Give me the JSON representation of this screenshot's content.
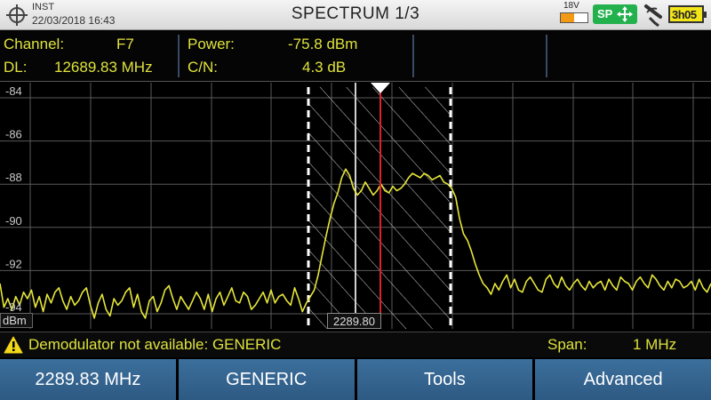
{
  "status_bar": {
    "mode": "INST",
    "datetime": "22/03/2018 16:43",
    "title": "SPECTRUM 1/3",
    "lnb_voltage": "18V",
    "lnb_level": 0.5,
    "sp_badge": "SP",
    "battery": "3h05",
    "icons": [
      "crosshair-icon",
      "move-arrows-icon",
      "antenna-icon",
      "battery-icon"
    ]
  },
  "info": {
    "channel_label": "Channel:",
    "channel_value": "F7",
    "dl_label": "DL:",
    "dl_value": "12689.83 MHz",
    "power_label": "Power:",
    "power_value": "-75.8 dBm",
    "cn_label": "C/N:",
    "cn_value": "4.3 dB"
  },
  "colors": {
    "trace": "#e6e63a",
    "marker": "#e0202a",
    "text": "#dfe33c",
    "softkey": "#33628e"
  },
  "chart_data": {
    "type": "line",
    "ylabel": "dBm",
    "y_ticks": [
      "-84",
      "-86",
      "-88",
      "-90",
      "-92",
      "-94"
    ],
    "ylim": [
      -94.7,
      -83.3
    ],
    "marker_label": "2289.80",
    "grid": true,
    "series": [
      {
        "values": [
          -92.6,
          -93.7,
          -93.3,
          -93.8,
          -93.2,
          -93.6,
          -93.0,
          -93.3,
          -92.9,
          -93.7,
          -93.2,
          -93.9,
          -93.1,
          -93.5,
          -93.0,
          -92.8,
          -93.4,
          -93.8,
          -93.2,
          -93.6,
          -93.4,
          -93.0,
          -92.8,
          -93.6,
          -94.2,
          -93.5,
          -93.1,
          -93.8,
          -94.1,
          -93.3,
          -93.6,
          -93.4,
          -93.0,
          -92.8,
          -93.7,
          -93.1,
          -93.9,
          -94.2,
          -93.4,
          -93.2,
          -93.9,
          -93.5,
          -92.9,
          -92.7,
          -93.3,
          -93.8,
          -93.2,
          -93.5,
          -93.8,
          -93.4,
          -93.0,
          -93.3,
          -93.8,
          -93.1,
          -93.9,
          -93.3,
          -93.0,
          -93.6,
          -93.2,
          -92.8,
          -93.4,
          -93.5,
          -93.0,
          -93.2,
          -93.8,
          -93.6,
          -93.3,
          -93.0,
          -93.5,
          -92.9,
          -93.5,
          -93.2,
          -93.1,
          -93.4,
          -93.6,
          -92.8,
          -93.3,
          -93.9,
          -93.5,
          -93.2,
          -92.9,
          -92.2,
          -91.3,
          -90.4,
          -89.6,
          -88.9,
          -88.4,
          -87.7,
          -87.3,
          -87.6,
          -88.2,
          -88.5,
          -88.3,
          -87.9,
          -88.2,
          -88.5,
          -88.3,
          -88.0,
          -88.3,
          -88.4,
          -88.1,
          -88.3,
          -88.2,
          -88.0,
          -87.7,
          -87.5,
          -87.6,
          -87.7,
          -87.5,
          -87.6,
          -87.8,
          -87.7,
          -87.6,
          -87.9,
          -88.0,
          -88.2,
          -88.6,
          -89.6,
          -90.3,
          -90.6,
          -91.1,
          -91.7,
          -92.2,
          -92.6,
          -92.8,
          -93.1,
          -92.6,
          -92.9,
          -92.5,
          -92.2,
          -92.8,
          -92.4,
          -92.9,
          -93.0,
          -92.5,
          -92.3,
          -92.6,
          -92.9,
          -93.0,
          -92.4,
          -92.2,
          -92.6,
          -92.8,
          -92.3,
          -92.7,
          -92.9,
          -92.6,
          -92.4,
          -92.7,
          -92.9,
          -92.5,
          -92.8,
          -92.6,
          -92.5,
          -92.9,
          -92.4,
          -92.7,
          -92.9,
          -92.3,
          -92.5,
          -92.6,
          -92.9,
          -92.5,
          -92.3,
          -92.6,
          -92.8,
          -92.2,
          -92.4,
          -92.7,
          -92.9,
          -92.5,
          -92.8,
          -92.4,
          -92.5,
          -92.8,
          -92.7,
          -92.5,
          -92.9,
          -92.4,
          -92.8,
          -93.0,
          -92.6
        ]
      }
    ]
  },
  "warning": {
    "text": "Demodulator not available: GENERIC",
    "span_label": "Span:",
    "span_value": "1 MHz"
  },
  "softkeys": [
    "2289.83 MHz",
    "GENERIC",
    "Tools",
    "Advanced"
  ]
}
